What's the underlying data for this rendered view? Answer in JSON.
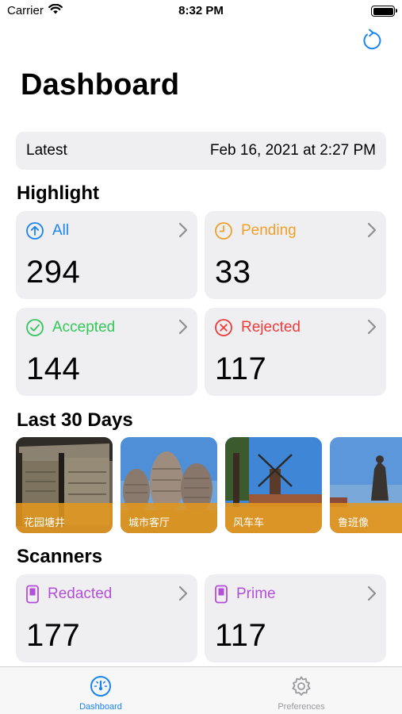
{
  "status_bar": {
    "carrier": "Carrier",
    "time": "8:32 PM"
  },
  "page": {
    "title": "Dashboard"
  },
  "latest": {
    "label": "Latest",
    "value": "Feb 16, 2021 at 2:27 PM"
  },
  "highlight": {
    "title": "Highlight",
    "cards": [
      {
        "label": "All",
        "value": "294",
        "color": "#1a84f0",
        "icon": "arrow-up-circle-icon"
      },
      {
        "label": "Pending",
        "value": "33",
        "color": "#f0a02a",
        "icon": "clock-icon"
      },
      {
        "label": "Accepted",
        "value": "144",
        "color": "#34c759",
        "icon": "checkmark-circle-icon"
      },
      {
        "label": "Rejected",
        "value": "117",
        "color": "#ef3b3b",
        "icon": "x-circle-icon"
      }
    ]
  },
  "last30": {
    "title": "Last 30 Days",
    "items": [
      {
        "caption": "花园塘井"
      },
      {
        "caption": "城市客厅"
      },
      {
        "caption": "风车车"
      },
      {
        "caption": "鲁班像"
      }
    ]
  },
  "scanners": {
    "title": "Scanners",
    "cards": [
      {
        "label": "Redacted",
        "value": "177",
        "color": "#b24fd8",
        "icon": "phone-icon"
      },
      {
        "label": "Prime",
        "value": "117",
        "color": "#b24fd8",
        "icon": "phone-icon"
      }
    ]
  },
  "tab_bar": {
    "tabs": [
      {
        "label": "Dashboard",
        "active": true,
        "color": "#1a84f0"
      },
      {
        "label": "Preferences",
        "active": false,
        "color": "#9a9a9e"
      }
    ]
  }
}
